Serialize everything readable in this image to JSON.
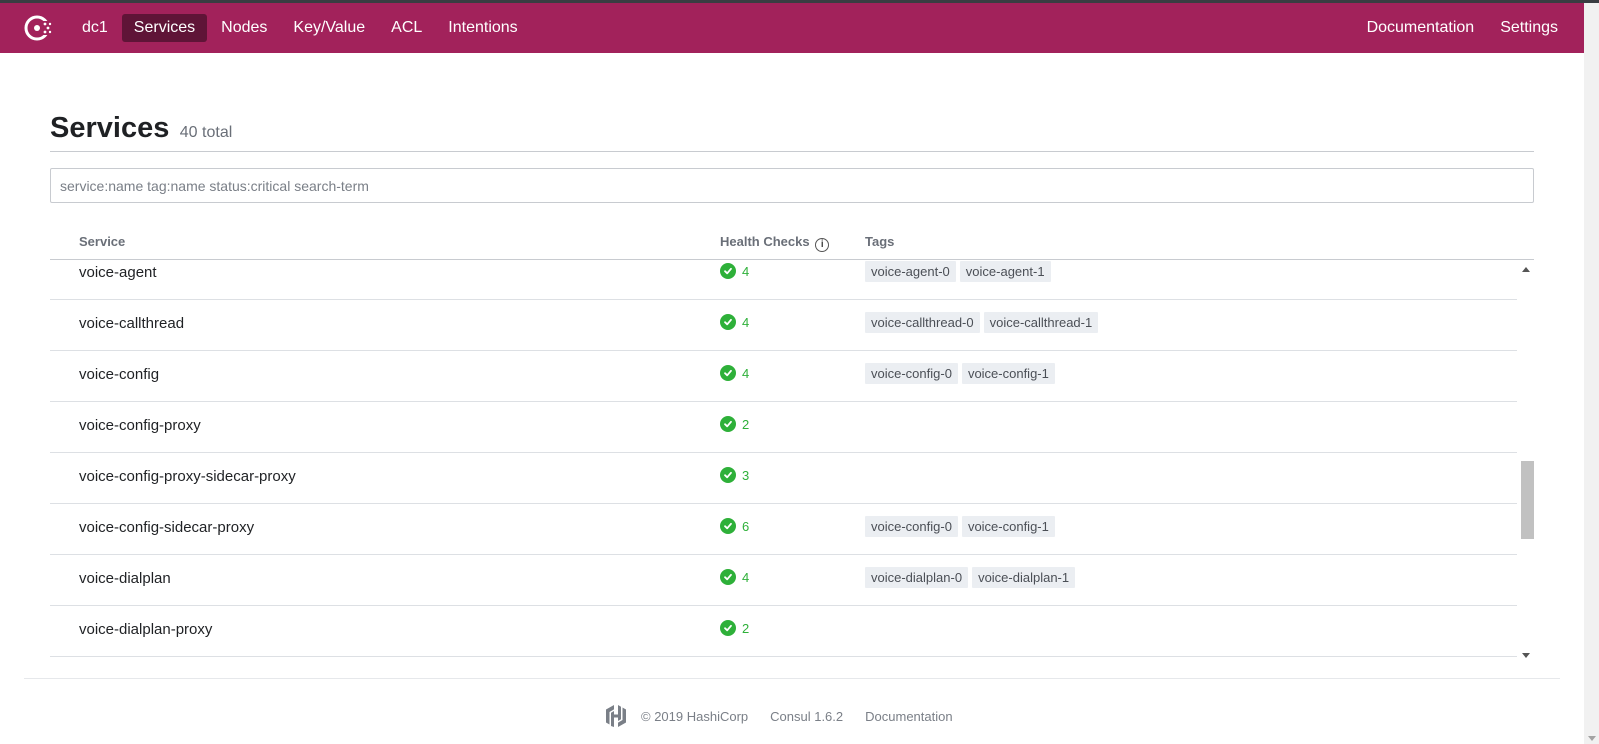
{
  "nav": {
    "datacenter": "dc1",
    "items": [
      "Services",
      "Nodes",
      "Key/Value",
      "ACL",
      "Intentions"
    ],
    "right": [
      "Documentation",
      "Settings"
    ],
    "active": "Services",
    "brand_color": "#a2225b"
  },
  "page": {
    "title": "Services",
    "total": "40 total",
    "search_placeholder": "service:name tag:name status:critical search-term"
  },
  "table": {
    "headers": {
      "service": "Service",
      "health": "Health Checks",
      "tags": "Tags"
    },
    "rows": [
      {
        "name": "voice-agent",
        "checks": "4",
        "tags": [
          "voice-agent-0",
          "voice-agent-1"
        ]
      },
      {
        "name": "voice-callthread",
        "checks": "4",
        "tags": [
          "voice-callthread-0",
          "voice-callthread-1"
        ]
      },
      {
        "name": "voice-config",
        "checks": "4",
        "tags": [
          "voice-config-0",
          "voice-config-1"
        ]
      },
      {
        "name": "voice-config-proxy",
        "checks": "2",
        "tags": []
      },
      {
        "name": "voice-config-proxy-sidecar-proxy",
        "checks": "3",
        "tags": []
      },
      {
        "name": "voice-config-sidecar-proxy",
        "checks": "6",
        "tags": [
          "voice-config-0",
          "voice-config-1"
        ]
      },
      {
        "name": "voice-dialplan",
        "checks": "4",
        "tags": [
          "voice-dialplan-0",
          "voice-dialplan-1"
        ]
      },
      {
        "name": "voice-dialplan-proxy",
        "checks": "2",
        "tags": []
      }
    ]
  },
  "footer": {
    "copyright": "© 2019 HashiCorp",
    "version": "Consul 1.6.2",
    "docs": "Documentation"
  }
}
